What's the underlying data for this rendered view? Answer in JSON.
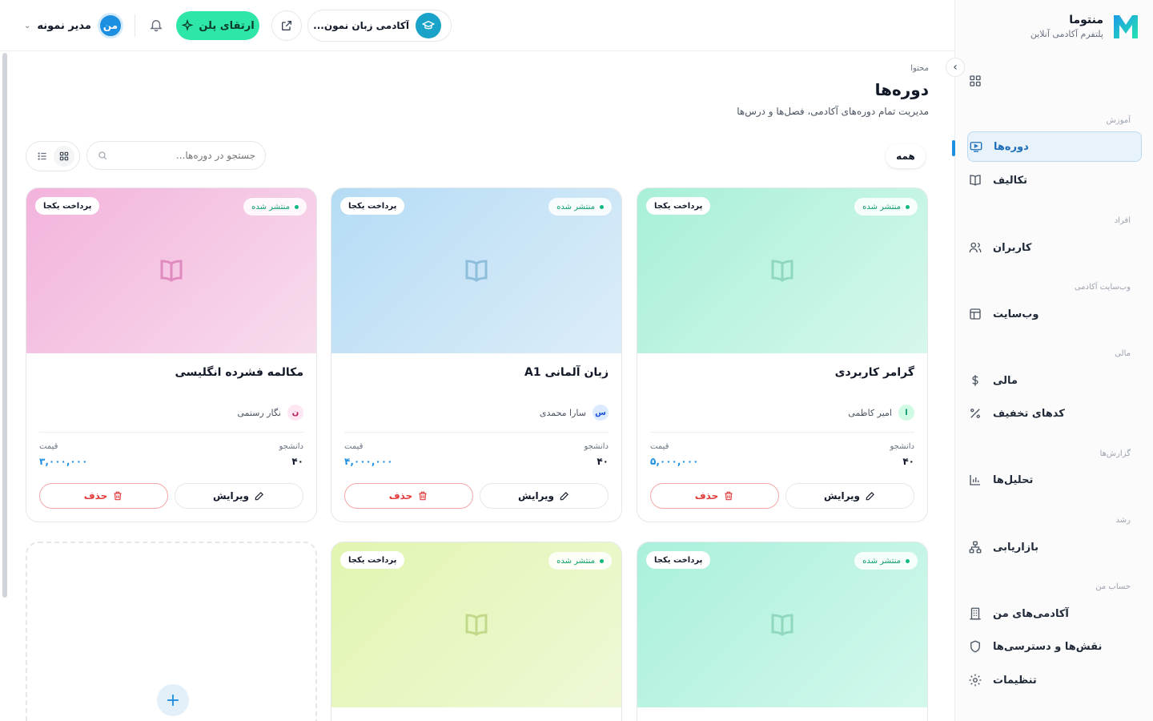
{
  "brand": {
    "name": "منتوما",
    "subtitle": "پلتفرم آکادمی آنلاین"
  },
  "header": {
    "academy_name": "آکادمی زبان نمون...",
    "upgrade_label": "ارتقای پلن",
    "user_initials": "من",
    "user_name": "مدیر نمونه"
  },
  "sidebar": {
    "dashboard": "داشبورد",
    "sections": {
      "education": "آموزش",
      "people": "افراد",
      "website": "وب‌سایت آکادمی",
      "finance": "مالی",
      "reports": "گزارش‌ها",
      "growth": "رشد",
      "account": "حساب من"
    },
    "items": {
      "courses": "دوره‌ها",
      "assignments": "تکالیف",
      "users": "کاربران",
      "website": "وب‌سایت",
      "finance": "مالی",
      "discounts": "کدهای تخفیف",
      "analytics": "تحلیل‌ها",
      "marketing": "بازاریابی",
      "my_academies": "آکادمی‌های من",
      "roles": "نقش‌ها و دسترسی‌ها",
      "settings": "تنظیمات"
    },
    "active": "courses"
  },
  "page": {
    "breadcrumb": "محتوا",
    "title": "دوره‌ها",
    "subtitle": "مدیریت تمام دوره‌های آکادمی، فصل‌ها و درس‌ها",
    "filter_all": "همه",
    "search_placeholder": "جستجو در دوره‌ها..."
  },
  "labels": {
    "published": "منتشر شده",
    "one_time": "پرداخت یکجا",
    "students": "دانشجو",
    "price": "قیمت",
    "edit": "ویرایش",
    "delete": "حذف"
  },
  "courses": [
    {
      "title": "گرامر کاربردی",
      "instructor": "امیر کاظمی",
      "initial": "ا",
      "students": "۴۰",
      "price": "۵,۰۰۰,۰۰۰",
      "color_from": "#a8f0d8",
      "color_to": "#d6f7ec",
      "icon_color": "#8fd8bd",
      "ini_bg": "#d1fae5",
      "ini_fg": "#059669"
    },
    {
      "title": "زبان آلمانی A1",
      "instructor": "سارا محمدی",
      "initial": "س",
      "students": "۴۰",
      "price": "۴,۰۰۰,۰۰۰",
      "color_from": "#b5dcf5",
      "color_to": "#dcedf8",
      "icon_color": "#8fbedc",
      "ini_bg": "#dbeafe",
      "ini_fg": "#1d4ed8"
    },
    {
      "title": "مکالمه فشرده انگلیسی",
      "instructor": "نگار رستمی",
      "initial": "ن",
      "students": "۴۰",
      "price": "۳,۰۰۰,۰۰۰",
      "color_from": "#f3b3dc",
      "color_to": "#f7dcec",
      "icon_color": "#e08ac0",
      "ini_bg": "#fce7f3",
      "ini_fg": "#be185d"
    },
    {
      "color_from": "#aaf0dc",
      "color_to": "#d3f8ec",
      "icon_color": "#8fd8bd"
    },
    {
      "color_from": "#e2f5b0",
      "color_to": "#eef8d6",
      "icon_color": "#c2d98a"
    }
  ]
}
